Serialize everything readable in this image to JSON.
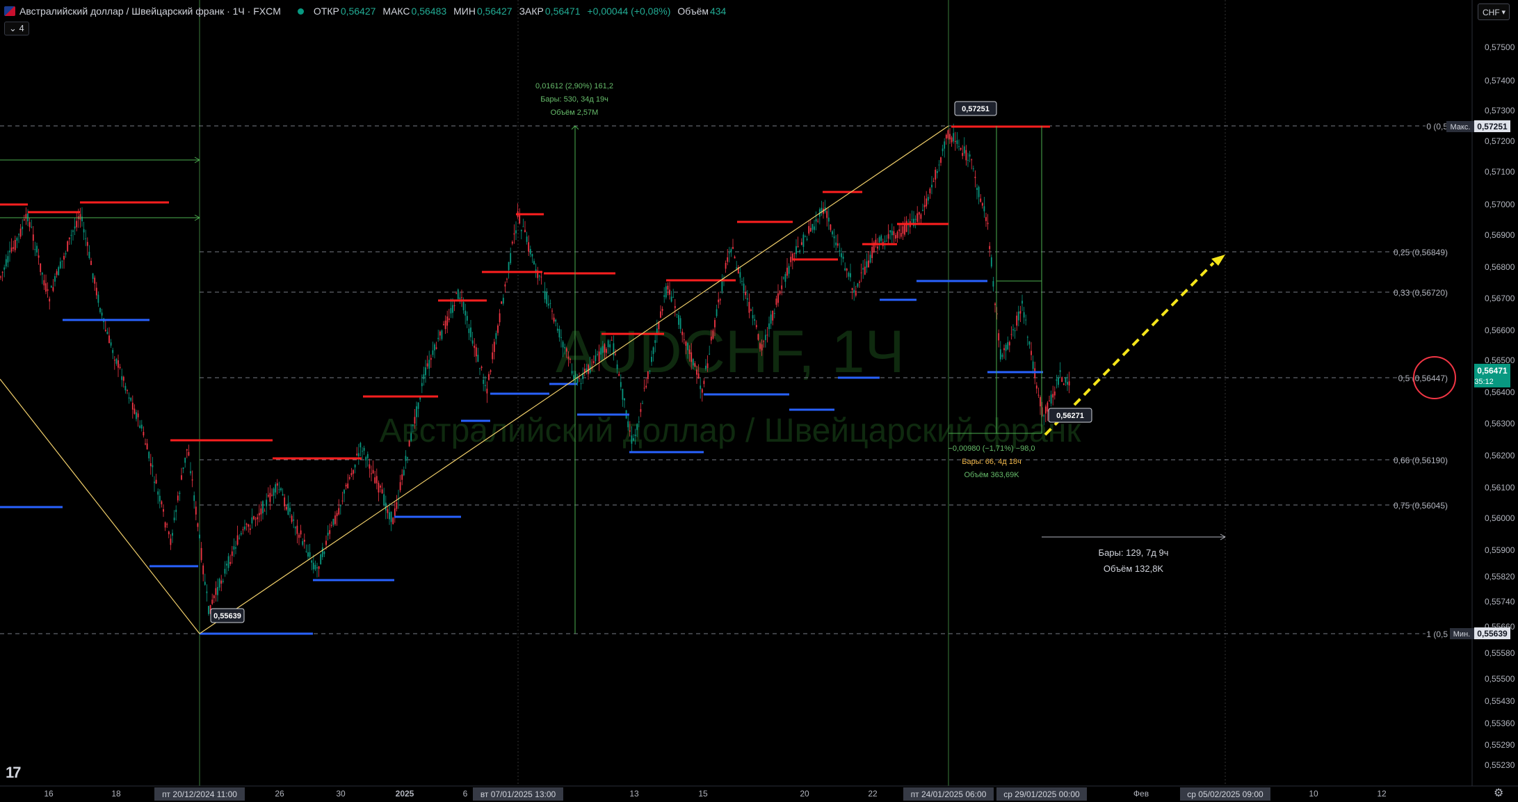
{
  "header": {
    "symbol_title": "Австралийский доллар / Швейцарский франк · 1Ч · FXCM",
    "open_label": "ОТКР",
    "open_value": "0,56427",
    "high_label": "МАКС",
    "high_value": "0,56483",
    "low_label": "МИН",
    "low_value": "0,56427",
    "close_label": "ЗАКР",
    "close_value": "0,56471",
    "change": "+0,00044 (+0,08%)",
    "volume_label": "Объём",
    "volume_value": "434",
    "interval_badge": "4",
    "currency": "CHF"
  },
  "watermark": {
    "line1": "AUDCHF, 1Ч",
    "line2": "Австралийский доллар / Швейцарский франк"
  },
  "price_axis": {
    "ticks": [
      "0,57500",
      "0,57400",
      "0,57300",
      "0,57200",
      "0,57100",
      "0,57000",
      "0,56900",
      "0,56800",
      "0,56700",
      "0,56600",
      "0,56500",
      "0,56400",
      "0,56300",
      "0,56200",
      "0,56100",
      "0,56000",
      "0,55900",
      "0,55820",
      "0,55740",
      "0,55660",
      "0,55580",
      "0,55500",
      "0,55430",
      "0,55360",
      "0,55290",
      "0,55230"
    ],
    "max_label": "Макс.",
    "max_value": "0,57251",
    "min_label": "Мин.",
    "min_value": "0,55639",
    "current_price": "0,56471",
    "countdown": "35:12"
  },
  "time_axis": {
    "ticks": [
      "16",
      "18",
      "26",
      "30",
      "2025",
      "6",
      "13",
      "15",
      "20",
      "22",
      "Фев",
      "10",
      "12"
    ],
    "highlighted": [
      "пт 20/12/2024 11:00",
      "вт 07/01/2025 13:00",
      "пт 24/01/2025 06:00",
      "ср 29/01/2025 00:00",
      "ср 05/02/2025 09:00"
    ]
  },
  "fib_levels": [
    "0 (0,5",
    "0,25 (0,56849)",
    "0,33 (0,56720)",
    "0,5 (0,56447)",
    "0,66 (0,56190)",
    "0,75 (0,56045)",
    "1 (0,5"
  ],
  "annotations": {
    "point_low": "0,55639",
    "point_high": "0,57251",
    "point_recent_low": "0,56271",
    "range1_line1": "0,01612 (2,90%) 161,2",
    "range1_line2": "Бары: 530, 34д 19ч",
    "range1_line3": "Объём 2,57M",
    "range2_line1": "−0,00980 (−1,71%) −98,0",
    "range2_line2": "Бары: 66, 4д 18ч",
    "range2_line3": "Объём 363,69K",
    "projection_line1": "Бары: 129, 7д 9ч",
    "projection_line2": "Объём 132,8K"
  },
  "logo_text": "17",
  "colors": {
    "up": "#089981",
    "down": "#f23645",
    "support": "#2962ff",
    "resistance": "#ff1f1f",
    "trend": "#f2d06b",
    "arrow": "#f5e51a",
    "measure": "#4caf50",
    "circle": "#f23645"
  }
}
